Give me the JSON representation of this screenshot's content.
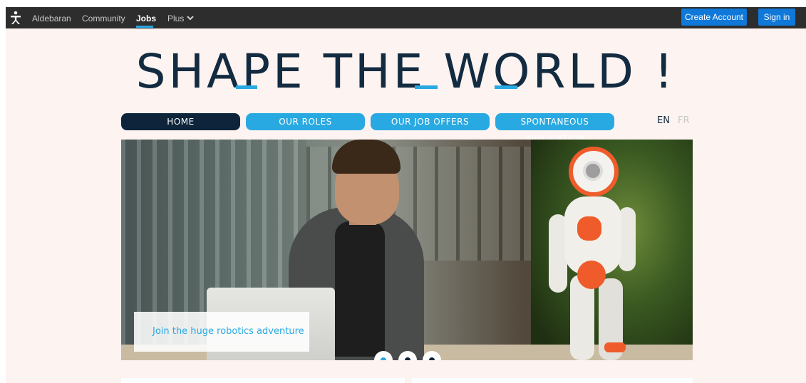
{
  "topbar": {
    "items": [
      {
        "label": "Aldebaran"
      },
      {
        "label": "Community"
      },
      {
        "label": "Jobs"
      },
      {
        "label": "Plus"
      }
    ],
    "create_account": "Create Account",
    "sign_in": "Sign in"
  },
  "headline": {
    "text": "SHAPE THE WORLD !"
  },
  "nav": {
    "home": "HOME",
    "roles": "OUR ROLES",
    "offers": "OUR JOB OFFERS",
    "spontaneous": "SPONTANEOUS APPLICATION"
  },
  "languages": {
    "en": "EN",
    "fr": "FR"
  },
  "hero": {
    "caption": "Join the huge robotics adventure",
    "slides_total": 3,
    "active_slide": 1
  },
  "colors": {
    "accent": "#29a9e1",
    "navy": "#0d243a",
    "topbar": "#2d2d2d",
    "button_blue": "#0f78d8",
    "page_bg": "#fdf3f1"
  }
}
